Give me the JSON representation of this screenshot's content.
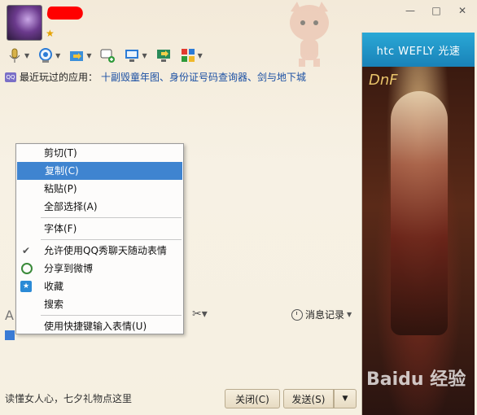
{
  "header": {
    "window_controls": [
      "—",
      "□",
      "✕"
    ],
    "recent_apps": {
      "label": "最近玩过的应用：",
      "apps": "十副毁童年图、身份证号码查询器、剑与地下城"
    }
  },
  "ad": {
    "brand": "htc WEFLY 光速",
    "logo_text": "DnF"
  },
  "context_menu": {
    "items": [
      {
        "label": "剪切(T)",
        "active": false
      },
      {
        "label": "复制(C)",
        "active": true
      },
      {
        "label": "粘贴(P)",
        "active": false
      },
      {
        "label": "全部选择(A)",
        "active": false
      },
      {
        "label": "字体(F)",
        "active": false
      },
      {
        "label": "允许使用QQ秀聊天随动表情",
        "active": false
      },
      {
        "label": "分享到微博",
        "active": false
      },
      {
        "label": "收藏",
        "active": false
      },
      {
        "label": "搜索",
        "active": false
      },
      {
        "label": "使用快捷键输入表情(U)",
        "active": false
      }
    ]
  },
  "input_toolbar": {
    "chat_log": "消息记录"
  },
  "footer": {
    "tip": "读懂女人心，七夕礼物点这里",
    "close_label": "关闭(C)",
    "send_label": "发送(S)",
    "watermark": "Baidu 经验"
  },
  "colors": {
    "accent": "#3f84d0",
    "link": "#1a4fa3"
  }
}
